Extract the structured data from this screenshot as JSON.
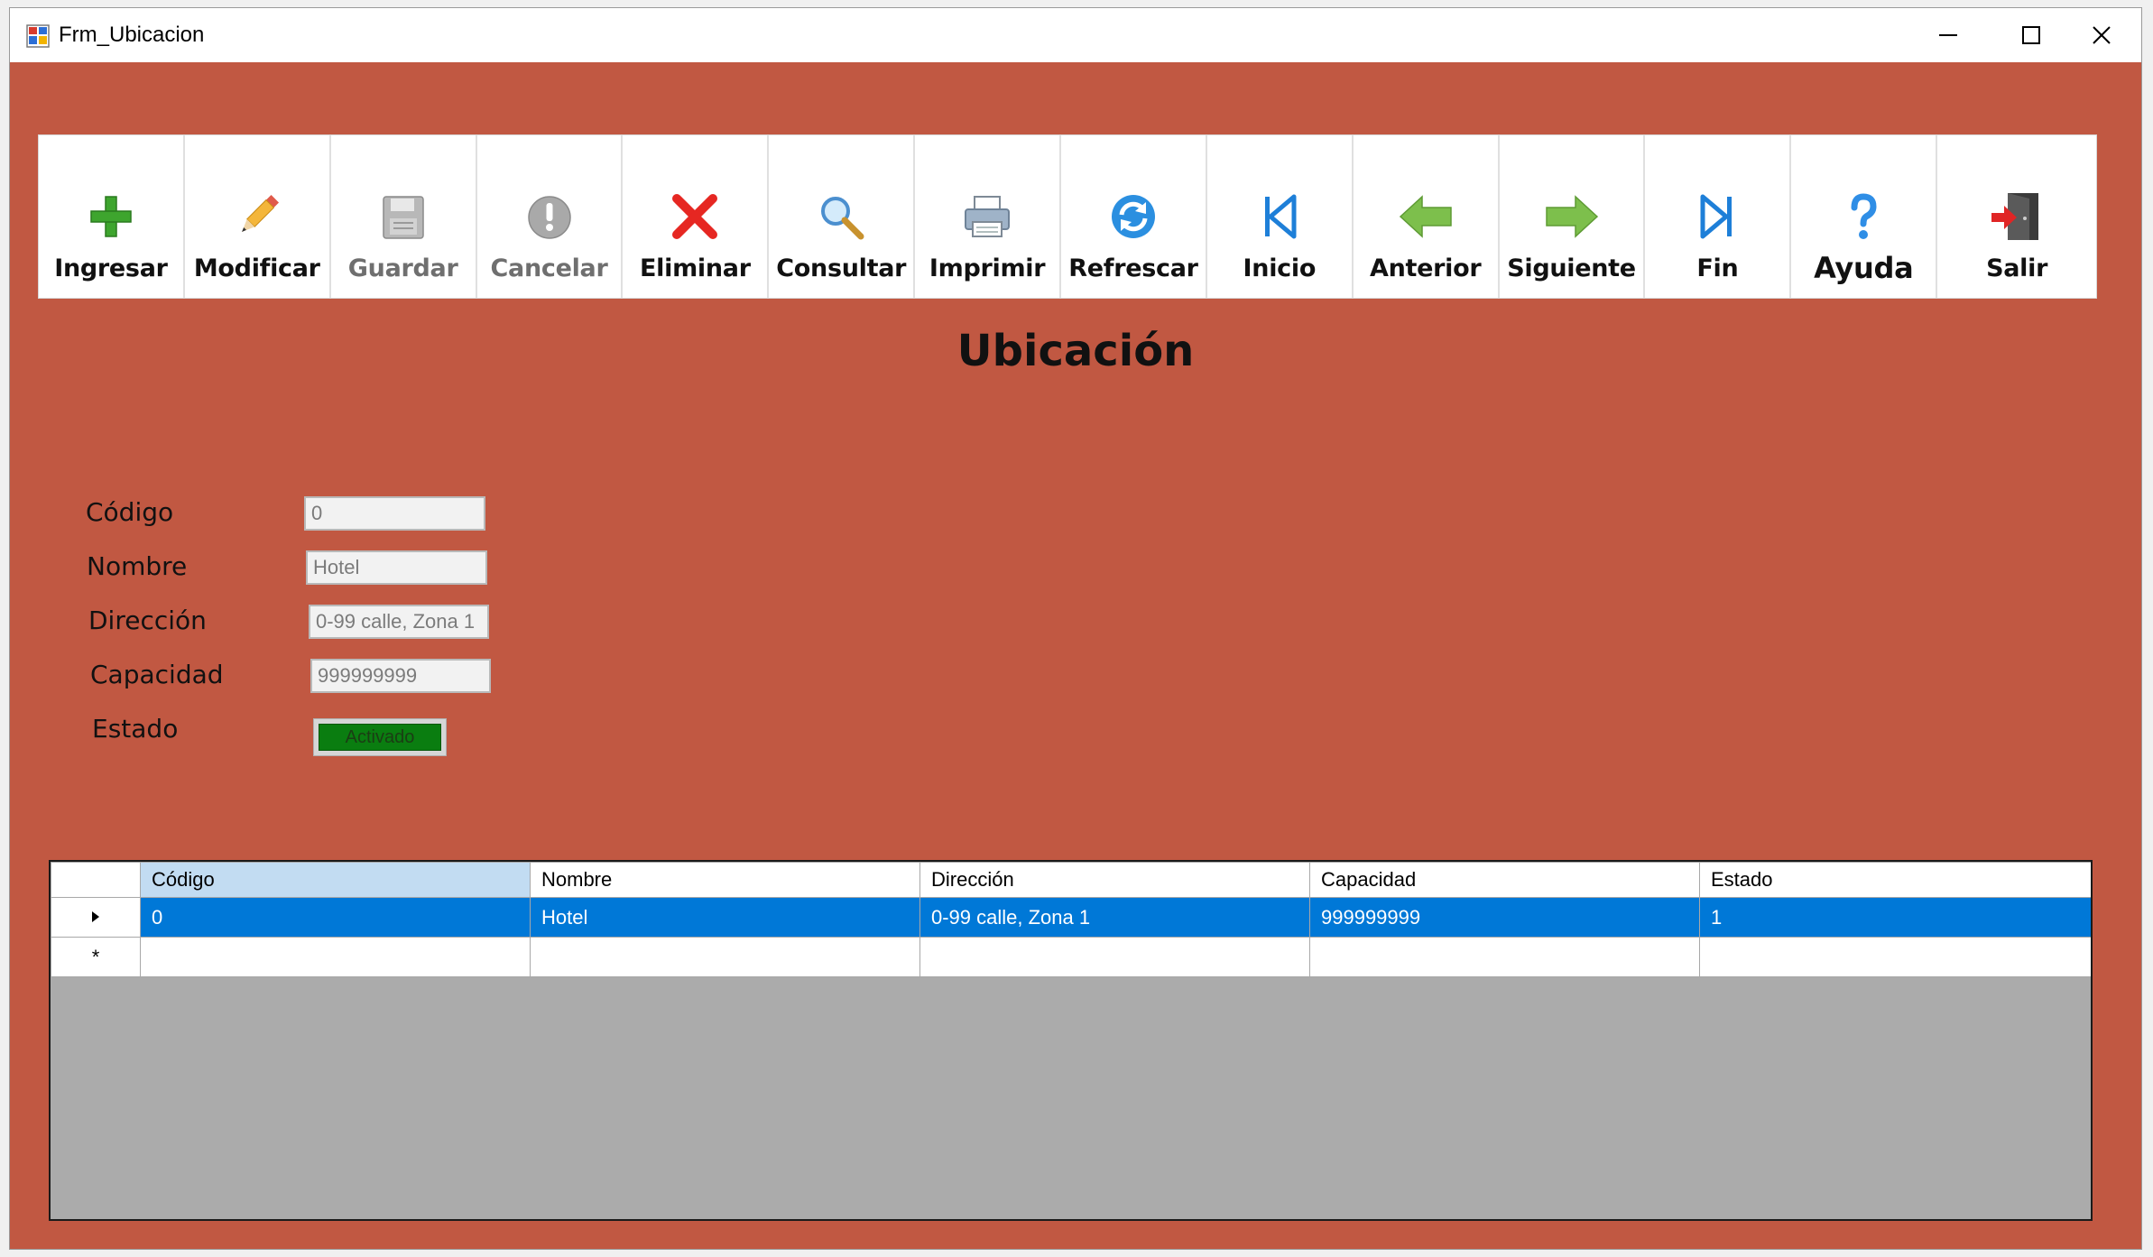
{
  "window": {
    "title": "Frm_Ubicacion"
  },
  "toolbar": {
    "buttons": [
      {
        "label": "Ingresar",
        "icon": "plus-icon",
        "enabled": true
      },
      {
        "label": "Modificar",
        "icon": "pencil-icon",
        "enabled": true
      },
      {
        "label": "Guardar",
        "icon": "floppy-disk-icon",
        "enabled": false
      },
      {
        "label": "Cancelar",
        "icon": "exclamation-circle-icon",
        "enabled": false
      },
      {
        "label": "Eliminar",
        "icon": "red-x-icon",
        "enabled": true
      },
      {
        "label": "Consultar",
        "icon": "magnifier-icon",
        "enabled": true
      },
      {
        "label": "Imprimir",
        "icon": "printer-icon",
        "enabled": true
      },
      {
        "label": "Refrescar",
        "icon": "refresh-icon",
        "enabled": true
      },
      {
        "label": "Inicio",
        "icon": "skip-first-icon",
        "enabled": true
      },
      {
        "label": "Anterior",
        "icon": "arrow-left-icon",
        "enabled": true
      },
      {
        "label": "Siguiente",
        "icon": "arrow-right-icon",
        "enabled": true
      },
      {
        "label": "Fin",
        "icon": "skip-last-icon",
        "enabled": true
      },
      {
        "label": "Ayuda",
        "icon": "help-icon",
        "enabled": true
      },
      {
        "label": "Salir",
        "icon": "exit-door-icon",
        "enabled": true
      }
    ]
  },
  "form": {
    "heading": "Ubicación",
    "fields": {
      "codigo": {
        "label": "Código",
        "value": "0"
      },
      "nombre": {
        "label": "Nombre",
        "value": "Hotel"
      },
      "direccion": {
        "label": "Dirección",
        "value": "0-99 calle, Zona 1"
      },
      "capacidad": {
        "label": "Capacidad",
        "value": "999999999"
      },
      "estado": {
        "label": "Estado",
        "value": "Activado"
      }
    }
  },
  "grid": {
    "columns": [
      "Código",
      "Nombre",
      "Dirección",
      "Capacidad",
      "Estado"
    ],
    "rows": [
      [
        "0",
        "Hotel",
        "0-99 calle, Zona 1",
        "999999999",
        "1"
      ]
    ],
    "new_row_marker": "*"
  },
  "colors": {
    "form_background": "#c15842",
    "selection": "#0078d7",
    "status_active": "#0a7d10"
  }
}
